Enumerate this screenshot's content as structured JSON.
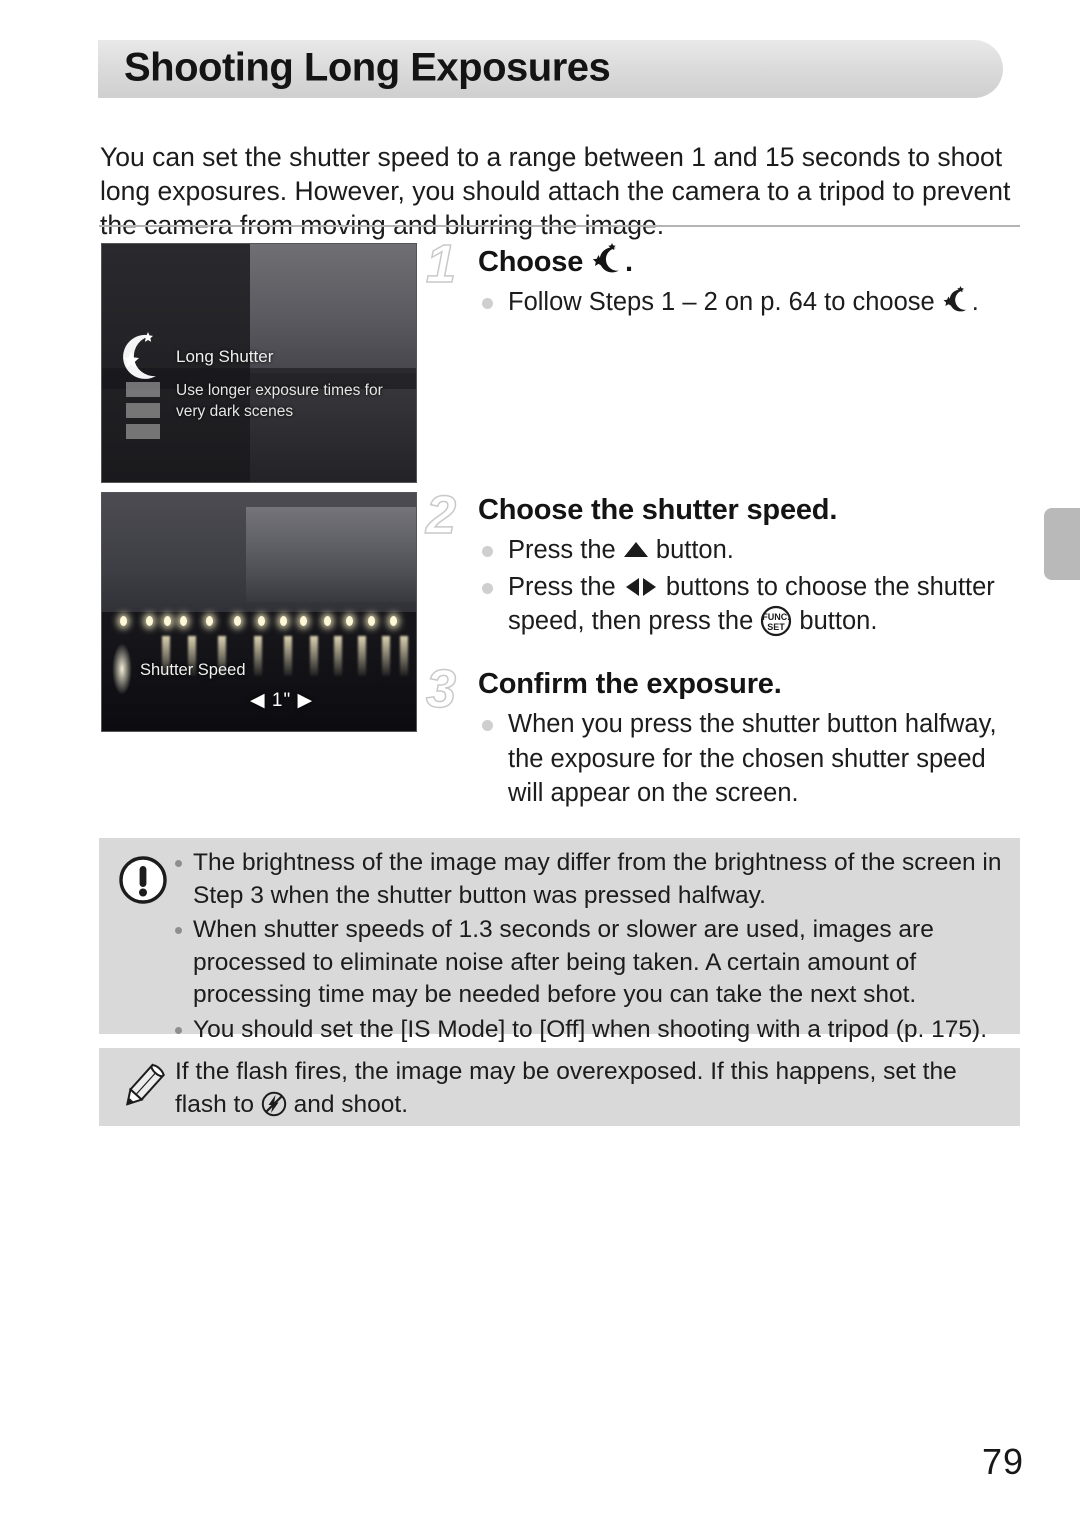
{
  "page": {
    "title": "Shooting Long Exposures",
    "number": "79",
    "intro": "You can set the shutter speed to a range between 1 and 15 seconds to shoot long exposures. However, you should attach the camera to a tripod to prevent the camera from moving and blurring the image."
  },
  "screens": {
    "shot1": {
      "mode_label": "Long Shutter",
      "mode_description": "Use longer exposure times for very dark scenes",
      "icon": "star-moon-icon"
    },
    "shot2": {
      "osd_label": "Shutter Speed",
      "osd_value": "◀ 1\" ▶",
      "value_only": "1\""
    }
  },
  "steps": [
    {
      "number": "1",
      "heading_prefix": "Choose ",
      "heading_suffix": ".",
      "heading_icon": "star-moon-icon",
      "bullets": [
        {
          "pre": "Follow Steps 1 – 2 on p. 64 to choose ",
          "icon": "star-moon-icon",
          "post": "."
        }
      ]
    },
    {
      "number": "2",
      "heading": "Choose the shutter speed.",
      "bullets": [
        {
          "pre": "Press the ",
          "icon": "up-arrow-icon",
          "post": " button."
        },
        {
          "pre": "Press the ",
          "icon": "left-right-arrow-icon",
          "mid": " buttons to choose the shutter speed, then press the ",
          "icon2": "func-set-icon",
          "post": " button."
        }
      ]
    },
    {
      "number": "3",
      "heading": "Confirm the exposure.",
      "bullets": [
        {
          "text": "When you press the shutter button halfway, the exposure for the chosen shutter speed will appear on the screen."
        }
      ]
    }
  ],
  "caution": {
    "icon": "exclamation-circle-icon",
    "items": [
      "The brightness of the image may differ from the brightness of the screen in Step 3 when the shutter button was pressed halfway.",
      "When shutter speeds of 1.3 seconds or slower are used, images are processed to eliminate noise after being taken. A certain amount of processing time may be needed before you can take the next shot.",
      "You should set the [IS Mode] to [Off] when shooting with a tripod (p. 175)."
    ]
  },
  "tip": {
    "icon": "pencil-icon",
    "pre": "If the flash fires, the image may be overexposed. If this happens, set the flash to ",
    "inline_icon": "flash-off-icon",
    "post": " and shoot."
  },
  "colors": {
    "banner_bg": "#dcdcdc",
    "note_bg": "#d9d9d9",
    "text": "#1c1c1c",
    "step_number_outline": "#c9c9c9",
    "bullet": "#cfcfcf",
    "tab": "#b9b9b9"
  }
}
